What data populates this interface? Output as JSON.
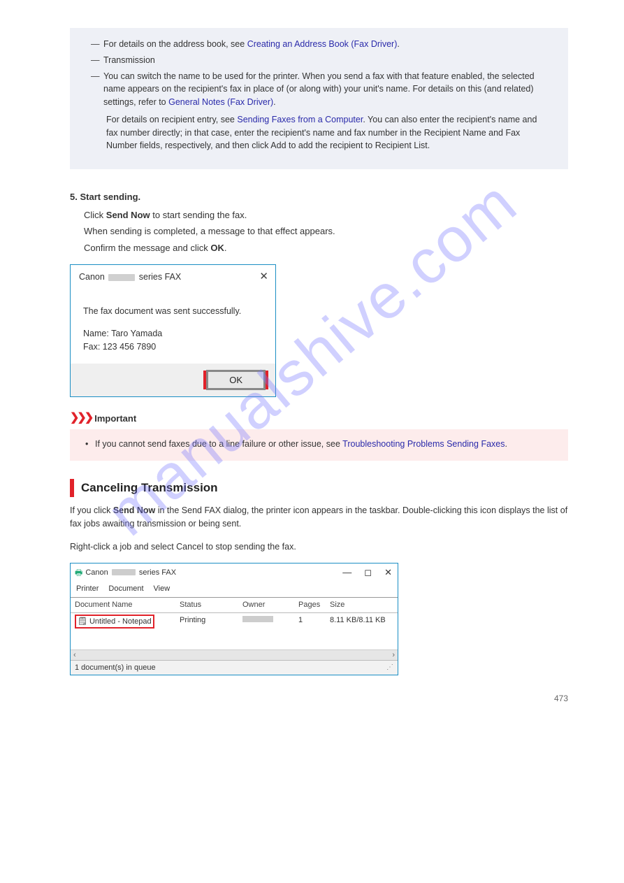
{
  "watermark": "manualshive.com",
  "bluebox": {
    "row1_pre": "For details on the address book, see ",
    "row1_link": "Creating an Address Book (Fax Driver)",
    "row1_post": ".",
    "row2": "Transmission",
    "row3_pre": "You can switch the name to be used for the printer. When you send a fax with that feature enabled, the selected name appears on the recipient's fax in place of (or along with) your unit's name. For details on this (and related) settings, refer to ",
    "row3_link": "General Notes (Fax Driver)",
    "row3_post": ".",
    "para_pre": "For details on recipient entry, see ",
    "para_link": "Sending Faxes from a Computer",
    "para_post": ". You can also enter the recipient's name and fax number directly; in that case, enter the recipient's name and fax number in the Recipient Name and Fax Number fields, respectively, and then click Add to add the recipient to Recipient List."
  },
  "step": {
    "num": "5.",
    "bold": "Start sending.",
    "line1_pre": "Click ",
    "line1_bold": "Send Now",
    "line1_post": " to start sending the fax.",
    "line2": "When sending is completed, a message to that effect appears.",
    "line3_pre": "Confirm the message and click ",
    "line3_bold": "OK",
    "line3_post": "."
  },
  "dialog": {
    "title_pre": "Canon ",
    "title_post": " series FAX",
    "body1": "The fax document was sent successfully.",
    "body2": "Name: Taro Yamada",
    "body3": "Fax: 123 456 7890",
    "ok": "OK"
  },
  "important": {
    "title": "Important",
    "text_pre": "If you cannot send faxes due to a line failure or other issue, see ",
    "text_link": "Troubleshooting Problems Sending Faxes",
    "text_post": "."
  },
  "cancel": {
    "heading": "Canceling Transmission",
    "p1_pre": "If you click ",
    "p1_bold": "Send Now",
    "p1_post": " in the Send FAX dialog, the printer icon appears in the taskbar. Double-clicking this icon displays the list of fax jobs awaiting transmission or being sent.",
    "p2": "Right-click a job and select Cancel to stop sending the fax."
  },
  "queue": {
    "title_pre": "Canon ",
    "title_post": " series FAX",
    "menu": [
      "Printer",
      "Document",
      "View"
    ],
    "headers": {
      "doc": "Document Name",
      "stat": "Status",
      "own": "Owner",
      "pg": "Pages",
      "sz": "Size"
    },
    "row": {
      "doc": "Untitled - Notepad",
      "stat": "Printing",
      "pg": "1",
      "sz": "8.11 KB/8.11 KB"
    },
    "status": "1 document(s) in queue"
  },
  "pagenum": "473"
}
